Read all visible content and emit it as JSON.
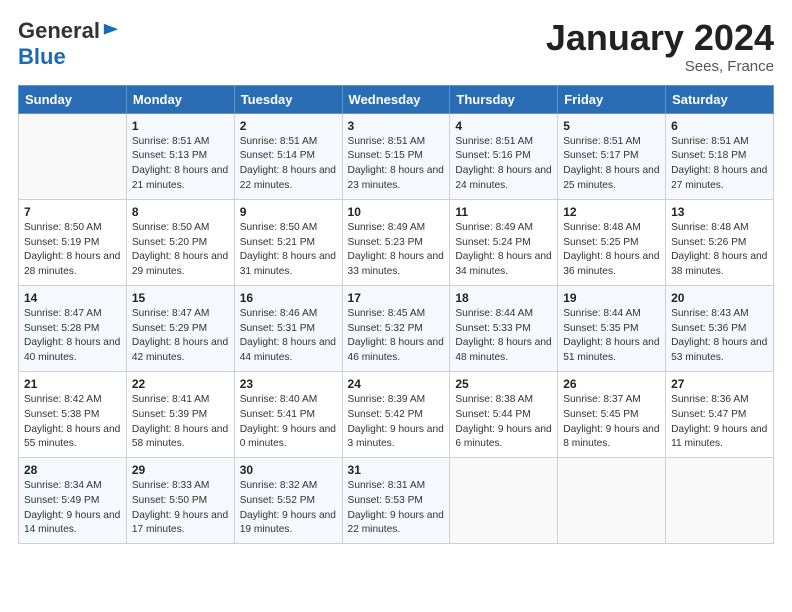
{
  "logo": {
    "general": "General",
    "blue": "Blue"
  },
  "header": {
    "month": "January 2024",
    "location": "Sees, France"
  },
  "weekdays": [
    "Sunday",
    "Monday",
    "Tuesday",
    "Wednesday",
    "Thursday",
    "Friday",
    "Saturday"
  ],
  "weeks": [
    [
      {
        "day": "",
        "sunrise": "",
        "sunset": "",
        "daylight": ""
      },
      {
        "day": "1",
        "sunrise": "Sunrise: 8:51 AM",
        "sunset": "Sunset: 5:13 PM",
        "daylight": "Daylight: 8 hours and 21 minutes."
      },
      {
        "day": "2",
        "sunrise": "Sunrise: 8:51 AM",
        "sunset": "Sunset: 5:14 PM",
        "daylight": "Daylight: 8 hours and 22 minutes."
      },
      {
        "day": "3",
        "sunrise": "Sunrise: 8:51 AM",
        "sunset": "Sunset: 5:15 PM",
        "daylight": "Daylight: 8 hours and 23 minutes."
      },
      {
        "day": "4",
        "sunrise": "Sunrise: 8:51 AM",
        "sunset": "Sunset: 5:16 PM",
        "daylight": "Daylight: 8 hours and 24 minutes."
      },
      {
        "day": "5",
        "sunrise": "Sunrise: 8:51 AM",
        "sunset": "Sunset: 5:17 PM",
        "daylight": "Daylight: 8 hours and 25 minutes."
      },
      {
        "day": "6",
        "sunrise": "Sunrise: 8:51 AM",
        "sunset": "Sunset: 5:18 PM",
        "daylight": "Daylight: 8 hours and 27 minutes."
      }
    ],
    [
      {
        "day": "7",
        "sunrise": "Sunrise: 8:50 AM",
        "sunset": "Sunset: 5:19 PM",
        "daylight": "Daylight: 8 hours and 28 minutes."
      },
      {
        "day": "8",
        "sunrise": "Sunrise: 8:50 AM",
        "sunset": "Sunset: 5:20 PM",
        "daylight": "Daylight: 8 hours and 29 minutes."
      },
      {
        "day": "9",
        "sunrise": "Sunrise: 8:50 AM",
        "sunset": "Sunset: 5:21 PM",
        "daylight": "Daylight: 8 hours and 31 minutes."
      },
      {
        "day": "10",
        "sunrise": "Sunrise: 8:49 AM",
        "sunset": "Sunset: 5:23 PM",
        "daylight": "Daylight: 8 hours and 33 minutes."
      },
      {
        "day": "11",
        "sunrise": "Sunrise: 8:49 AM",
        "sunset": "Sunset: 5:24 PM",
        "daylight": "Daylight: 8 hours and 34 minutes."
      },
      {
        "day": "12",
        "sunrise": "Sunrise: 8:48 AM",
        "sunset": "Sunset: 5:25 PM",
        "daylight": "Daylight: 8 hours and 36 minutes."
      },
      {
        "day": "13",
        "sunrise": "Sunrise: 8:48 AM",
        "sunset": "Sunset: 5:26 PM",
        "daylight": "Daylight: 8 hours and 38 minutes."
      }
    ],
    [
      {
        "day": "14",
        "sunrise": "Sunrise: 8:47 AM",
        "sunset": "Sunset: 5:28 PM",
        "daylight": "Daylight: 8 hours and 40 minutes."
      },
      {
        "day": "15",
        "sunrise": "Sunrise: 8:47 AM",
        "sunset": "Sunset: 5:29 PM",
        "daylight": "Daylight: 8 hours and 42 minutes."
      },
      {
        "day": "16",
        "sunrise": "Sunrise: 8:46 AM",
        "sunset": "Sunset: 5:31 PM",
        "daylight": "Daylight: 8 hours and 44 minutes."
      },
      {
        "day": "17",
        "sunrise": "Sunrise: 8:45 AM",
        "sunset": "Sunset: 5:32 PM",
        "daylight": "Daylight: 8 hours and 46 minutes."
      },
      {
        "day": "18",
        "sunrise": "Sunrise: 8:44 AM",
        "sunset": "Sunset: 5:33 PM",
        "daylight": "Daylight: 8 hours and 48 minutes."
      },
      {
        "day": "19",
        "sunrise": "Sunrise: 8:44 AM",
        "sunset": "Sunset: 5:35 PM",
        "daylight": "Daylight: 8 hours and 51 minutes."
      },
      {
        "day": "20",
        "sunrise": "Sunrise: 8:43 AM",
        "sunset": "Sunset: 5:36 PM",
        "daylight": "Daylight: 8 hours and 53 minutes."
      }
    ],
    [
      {
        "day": "21",
        "sunrise": "Sunrise: 8:42 AM",
        "sunset": "Sunset: 5:38 PM",
        "daylight": "Daylight: 8 hours and 55 minutes."
      },
      {
        "day": "22",
        "sunrise": "Sunrise: 8:41 AM",
        "sunset": "Sunset: 5:39 PM",
        "daylight": "Daylight: 8 hours and 58 minutes."
      },
      {
        "day": "23",
        "sunrise": "Sunrise: 8:40 AM",
        "sunset": "Sunset: 5:41 PM",
        "daylight": "Daylight: 9 hours and 0 minutes."
      },
      {
        "day": "24",
        "sunrise": "Sunrise: 8:39 AM",
        "sunset": "Sunset: 5:42 PM",
        "daylight": "Daylight: 9 hours and 3 minutes."
      },
      {
        "day": "25",
        "sunrise": "Sunrise: 8:38 AM",
        "sunset": "Sunset: 5:44 PM",
        "daylight": "Daylight: 9 hours and 6 minutes."
      },
      {
        "day": "26",
        "sunrise": "Sunrise: 8:37 AM",
        "sunset": "Sunset: 5:45 PM",
        "daylight": "Daylight: 9 hours and 8 minutes."
      },
      {
        "day": "27",
        "sunrise": "Sunrise: 8:36 AM",
        "sunset": "Sunset: 5:47 PM",
        "daylight": "Daylight: 9 hours and 11 minutes."
      }
    ],
    [
      {
        "day": "28",
        "sunrise": "Sunrise: 8:34 AM",
        "sunset": "Sunset: 5:49 PM",
        "daylight": "Daylight: 9 hours and 14 minutes."
      },
      {
        "day": "29",
        "sunrise": "Sunrise: 8:33 AM",
        "sunset": "Sunset: 5:50 PM",
        "daylight": "Daylight: 9 hours and 17 minutes."
      },
      {
        "day": "30",
        "sunrise": "Sunrise: 8:32 AM",
        "sunset": "Sunset: 5:52 PM",
        "daylight": "Daylight: 9 hours and 19 minutes."
      },
      {
        "day": "31",
        "sunrise": "Sunrise: 8:31 AM",
        "sunset": "Sunset: 5:53 PM",
        "daylight": "Daylight: 9 hours and 22 minutes."
      },
      {
        "day": "",
        "sunrise": "",
        "sunset": "",
        "daylight": ""
      },
      {
        "day": "",
        "sunrise": "",
        "sunset": "",
        "daylight": ""
      },
      {
        "day": "",
        "sunrise": "",
        "sunset": "",
        "daylight": ""
      }
    ]
  ]
}
